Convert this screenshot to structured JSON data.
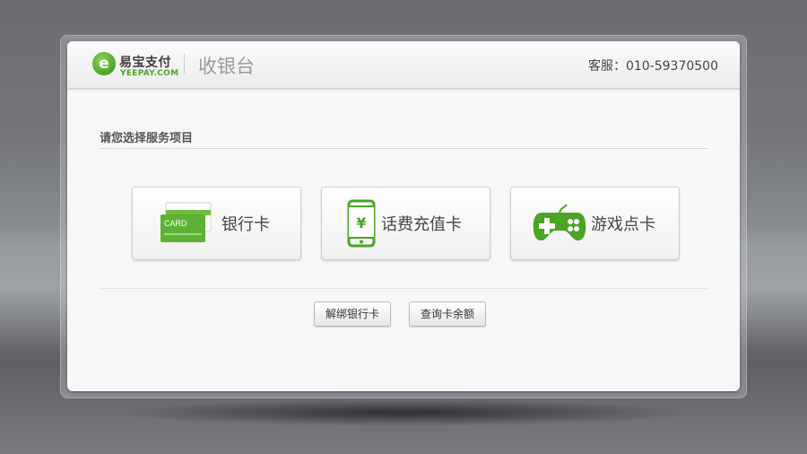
{
  "header": {
    "logo_cn": "易宝支付",
    "logo_en": "YEEPAY.COM",
    "title": "收银台",
    "service": "客服：010-59370500"
  },
  "main": {
    "section_label": "请您选择服务项目",
    "services": [
      {
        "label": "银行卡",
        "icon": "bank-card-icon",
        "icon_text": "CARD"
      },
      {
        "label": "话费充值卡",
        "icon": "mobile-phone-icon",
        "icon_text": "¥"
      },
      {
        "label": "游戏点卡",
        "icon": "gamepad-icon"
      }
    ],
    "actions": [
      {
        "label": "解绑银行卡"
      },
      {
        "label": "查询卡余额"
      }
    ]
  },
  "colors": {
    "brand_green": "#4aa524",
    "text_dark": "#444444"
  }
}
